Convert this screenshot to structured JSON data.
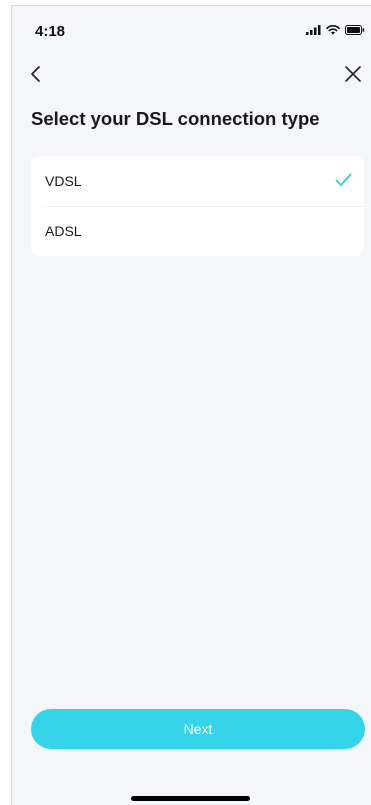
{
  "status_bar": {
    "time": "4:18",
    "icons": [
      "cellular-signal-icon",
      "wifi-icon",
      "battery-icon"
    ]
  },
  "nav": {
    "back_icon": "chevron-left-icon",
    "close_icon": "close-icon"
  },
  "page": {
    "title": "Select your DSL connection type"
  },
  "options": [
    {
      "label": "VDSL",
      "selected": true
    },
    {
      "label": "ADSL",
      "selected": false
    }
  ],
  "footer": {
    "next_label": "Next"
  },
  "colors": {
    "accent": "#35d4e8",
    "check": "#38c8e0",
    "background": "#f5f6fa",
    "card": "#ffffff"
  }
}
